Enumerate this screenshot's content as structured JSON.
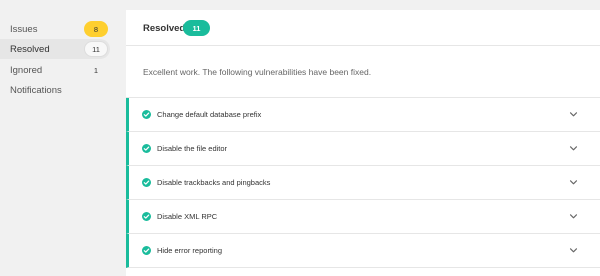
{
  "sidebar": {
    "items": [
      {
        "label": "Issues",
        "count": "8"
      },
      {
        "label": "Resolved",
        "count": "11"
      },
      {
        "label": "Ignored",
        "count": "1"
      },
      {
        "label": "Notifications"
      }
    ]
  },
  "main": {
    "title": "Resolved",
    "badge": "11",
    "description": "Excellent work. The following vulnerabilities have been fixed.",
    "issues": [
      {
        "label": "Change default database prefix"
      },
      {
        "label": "Disable the file editor"
      },
      {
        "label": "Disable trackbacks and pingbacks"
      },
      {
        "label": "Disable XML RPC"
      },
      {
        "label": "Hide error reporting"
      }
    ]
  },
  "colors": {
    "accent": "#1abc9c",
    "warning": "#fecf2f",
    "sidebar_bg": "#f1f1f1"
  },
  "icons": {
    "check": "check-circle-icon",
    "chevron": "chevron-down-icon"
  }
}
